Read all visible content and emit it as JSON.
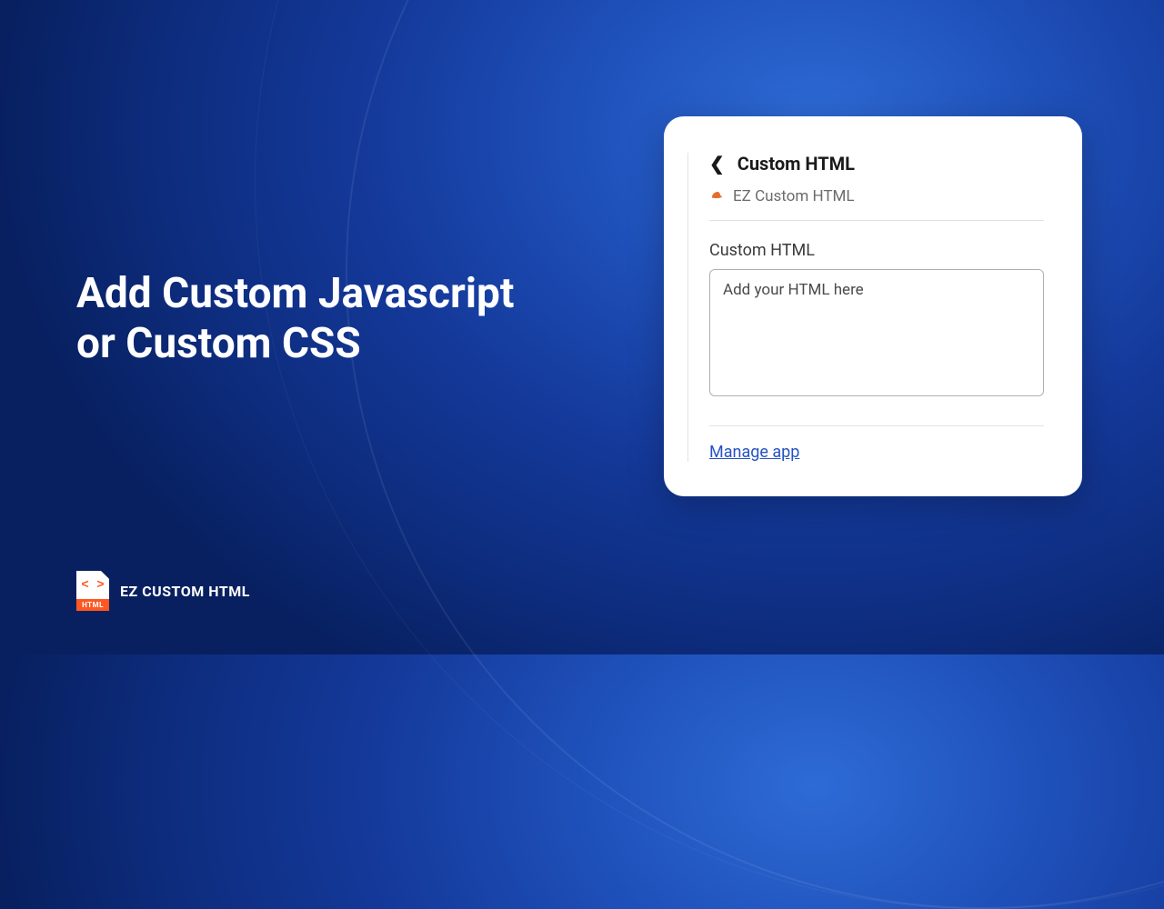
{
  "headline": "Add Custom Javascript\nor Custom CSS",
  "logo": {
    "brackets": "< >",
    "tag": "HTML",
    "text": "EZ CUSTOM HTML"
  },
  "panel": {
    "title": "Custom HTML",
    "app_name": "EZ Custom HTML",
    "field_label": "Custom HTML",
    "placeholder": "Add your HTML here",
    "manage_link": "Manage app"
  }
}
